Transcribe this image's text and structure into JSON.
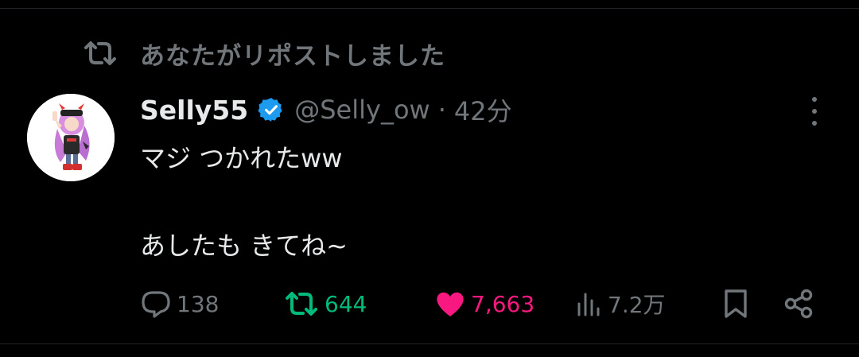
{
  "repost_banner": {
    "icon": "repost-icon",
    "text": "あなたがリポストしました"
  },
  "author": {
    "display_name": "Selly55",
    "verified": true,
    "handle": "@Selly_ow",
    "separator": "·",
    "time": "42分",
    "avatar": "avatar-illustration"
  },
  "tweet": {
    "line1": "マジ つかれたww",
    "line2": "あしたも きてね~"
  },
  "actions": {
    "reply_count": "138",
    "repost_count": "644",
    "like_count": "7,663",
    "views_count": "7.2万"
  },
  "colors": {
    "background": "#000000",
    "text": "#e7e9ea",
    "muted": "#71767b",
    "repost_green": "#00ba7c",
    "like_pink": "#f91880",
    "verified_blue": "#1d9bf0"
  }
}
